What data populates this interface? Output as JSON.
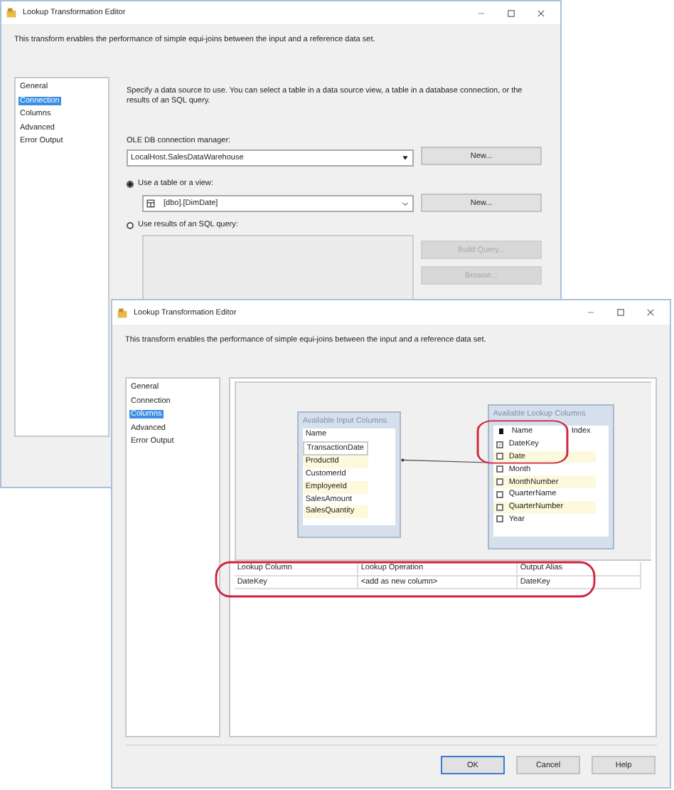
{
  "back_window": {
    "title": "Lookup Transformation Editor",
    "description": "This transform enables the performance of simple equi-joins between the input and a reference data set.",
    "nav": [
      {
        "label": "General",
        "selected": false
      },
      {
        "label": "Connection",
        "selected": true
      },
      {
        "label": "Columns",
        "selected": false
      },
      {
        "label": "Advanced",
        "selected": false
      },
      {
        "label": "Error Output",
        "selected": false
      }
    ],
    "instruction": "Specify a data source to use. You can select a table in a data source view, a table in a database connection, or the results of an SQL query.",
    "connection_label": "OLE DB connection manager:",
    "connection_value": "LocalHost.SalesDataWarehouse",
    "new_connection_button": "New...",
    "source_options": [
      {
        "label": "Use a table or a view:",
        "selected": true
      },
      {
        "label": "Use results of an SQL query:",
        "selected": false
      }
    ],
    "table_value": "[dbo].[DimDate]",
    "new_table_button": "New...",
    "query_buttons": [
      {
        "label": "Build Query...",
        "disabled": true
      },
      {
        "label": "Browse...",
        "disabled": true
      }
    ]
  },
  "front_window": {
    "title": "Lookup Transformation Editor",
    "description": "This transform enables the performance of simple equi-joins between the input and a reference data set.",
    "nav": [
      {
        "label": "General",
        "selected": false
      },
      {
        "label": "Connection",
        "selected": false
      },
      {
        "label": "Columns",
        "selected": true
      },
      {
        "label": "Advanced",
        "selected": false
      },
      {
        "label": "Error Output",
        "selected": false
      }
    ],
    "input_columns": {
      "title": "Available Input Columns",
      "header": "Name",
      "rows": [
        "TransactionDate",
        "ProductId",
        "CustomerId",
        "EmployeeId",
        "SalesAmount",
        "SalesQuantity"
      ]
    },
    "lookup_columns": {
      "title": "Available Lookup Columns",
      "headers": [
        "Name",
        "Index"
      ],
      "rows": [
        {
          "name": "DateKey",
          "checked": true
        },
        {
          "name": "Date",
          "checked": false
        },
        {
          "name": "Month",
          "checked": false
        },
        {
          "name": "MonthNumber",
          "checked": false
        },
        {
          "name": "QuarterName",
          "checked": false
        },
        {
          "name": "QuarterNumber",
          "checked": false
        },
        {
          "name": "Year",
          "checked": false
        }
      ]
    },
    "mapping": {
      "columns": [
        "Lookup Column",
        "Lookup Operation",
        "Output Alias"
      ],
      "rows": [
        [
          "DateKey",
          "<add as new column>",
          "DateKey"
        ]
      ]
    },
    "buttons": [
      "OK",
      "Cancel",
      "Help"
    ]
  }
}
